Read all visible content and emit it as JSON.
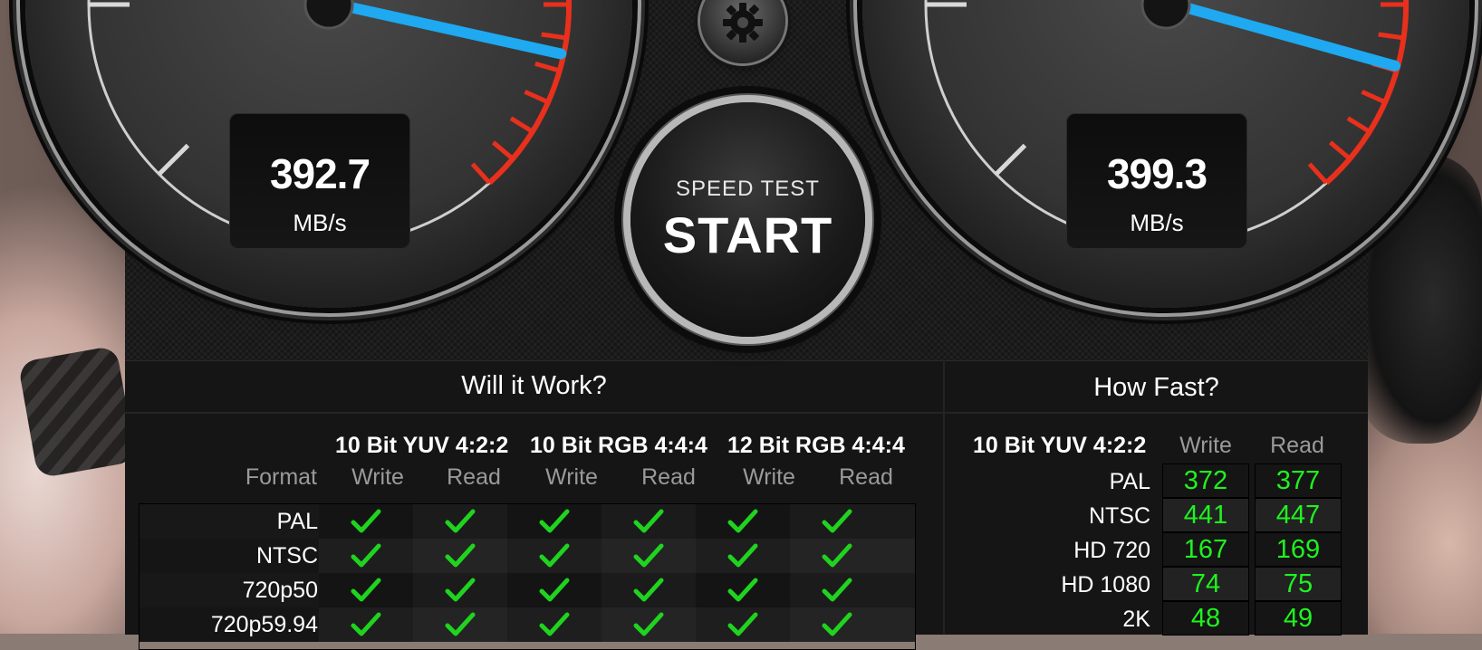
{
  "gauges": {
    "write": {
      "value": "392.7",
      "unit": "MB/s"
    },
    "read": {
      "value": "399.3",
      "unit": "MB/s"
    }
  },
  "start_button": {
    "line1": "SPEED TEST",
    "line2": "START"
  },
  "will_it_work": {
    "title": "Will it Work?",
    "format_label": "Format",
    "groups": [
      "10 Bit YUV 4:2:2",
      "10 Bit RGB 4:4:4",
      "12 Bit RGB 4:4:4"
    ],
    "write_label": "Write",
    "read_label": "Read",
    "rows": [
      "PAL",
      "NTSC",
      "720p50",
      "720p59.94"
    ]
  },
  "how_fast": {
    "title": "How Fast?",
    "group": "10 Bit YUV 4:2:2",
    "write_label": "Write",
    "read_label": "Read",
    "rows": [
      {
        "format": "PAL",
        "write": "372",
        "read": "377"
      },
      {
        "format": "NTSC",
        "write": "441",
        "read": "447"
      },
      {
        "format": "HD 720",
        "write": "167",
        "read": "169"
      },
      {
        "format": "HD 1080",
        "write": "74",
        "read": "75"
      },
      {
        "format": "2K",
        "write": "48",
        "read": "49"
      }
    ]
  },
  "colors": {
    "needle": "#1ea9f0",
    "check": "#1fd31f",
    "value_green": "#1ff31f",
    "redline": "#e8301c"
  }
}
